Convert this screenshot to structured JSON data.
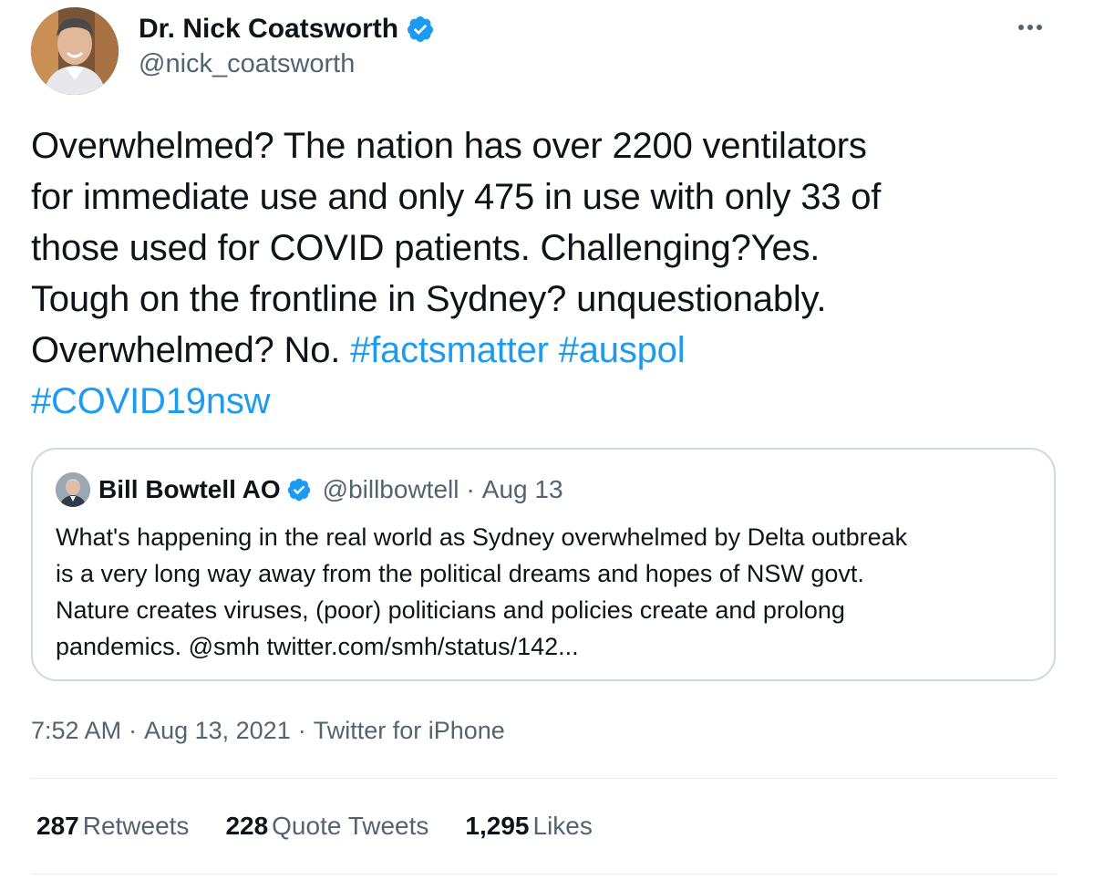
{
  "author": {
    "display_name": "Dr. Nick Coatsworth",
    "handle": "@nick_coatsworth",
    "verified_icon": "verified-badge-icon",
    "avatar_icon": "avatar-photo"
  },
  "more_icon": "more-options-icon",
  "tweet": {
    "lines": [
      [
        {
          "t": "Overwhelmed? The nation has over 2200 ventilators",
          "h": false
        }
      ],
      [
        {
          "t": "for immediate use and only 475 in use with only 33 of",
          "h": false
        }
      ],
      [
        {
          "t": "those used for COVID patients. Challenging?Yes.",
          "h": false
        }
      ],
      [
        {
          "t": "Tough on the frontline in Sydney? unquestionably.",
          "h": false
        }
      ],
      [
        {
          "t": "Overwhelmed? No. ",
          "h": false
        },
        {
          "t": "#factsmatter",
          "h": true
        },
        {
          "t": " ",
          "h": false
        },
        {
          "t": "#auspol",
          "h": true
        }
      ],
      [
        {
          "t": "#COVID19nsw",
          "h": true
        }
      ]
    ]
  },
  "quote": {
    "display_name": "Bill Bowtell AO",
    "handle": "@billbowtell",
    "separator": "·",
    "date": "Aug 13",
    "lines": [
      "What's happening in the real world as Sydney overwhelmed by Delta outbreak",
      "is a very long way away from the political dreams and hopes of NSW govt.",
      "Nature creates viruses, (poor) politicians and policies create and prolong",
      "pandemics. @smh twitter.com/smh/status/142..."
    ]
  },
  "meta": {
    "time": "7:52 AM",
    "dot": "·",
    "date": "Aug 13, 2021",
    "source": "Twitter for iPhone"
  },
  "stats": {
    "retweets": {
      "count": "287",
      "label": "Retweets"
    },
    "quotes": {
      "count": "228",
      "label": "Quote Tweets"
    },
    "likes": {
      "count": "1,295",
      "label": "Likes"
    }
  },
  "colors": {
    "link": "#1d9bf0",
    "secondary_text": "#536471",
    "primary_text": "#0f1419",
    "border": "#cfd9de"
  }
}
